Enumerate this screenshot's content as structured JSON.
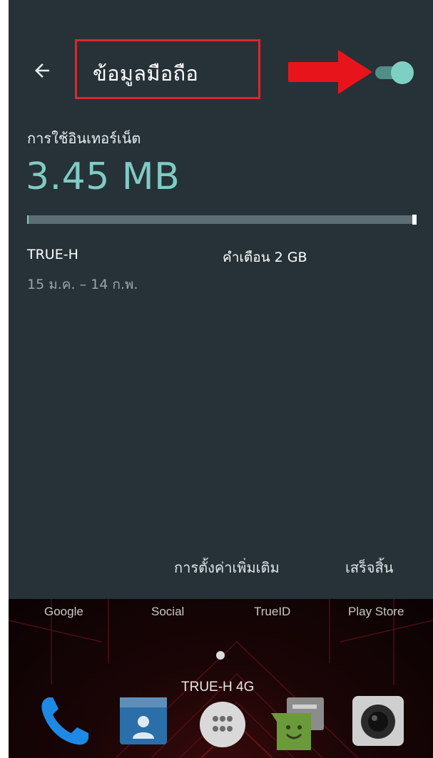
{
  "header": {
    "title": "ข้อมูลมือถือ",
    "back_icon": "arrow-left-icon",
    "toggle_state": "on"
  },
  "usage": {
    "label": "การใช้อินเทอร์เน็ต",
    "amount": "3.45 MB",
    "carrier": "TRUE-H",
    "period": "15 ม.ค. – 14 ก.พ.",
    "warning": "คำเตือน 2 GB"
  },
  "actions": {
    "more_settings": "การตั้งค่าเพิ่มเติม",
    "done": "เสร็จสิ้น"
  },
  "home": {
    "apps": [
      "Google",
      "Social",
      "TrueID",
      "Play Store"
    ],
    "carrier": "TRUE-H 4G",
    "dock": [
      "phone-icon",
      "contacts-icon",
      "app-drawer-icon",
      "messaging-icon",
      "camera-icon"
    ]
  },
  "colors": {
    "sheet_bg": "#263238",
    "accent": "#80cbc4",
    "highlight": "#e0262b"
  }
}
